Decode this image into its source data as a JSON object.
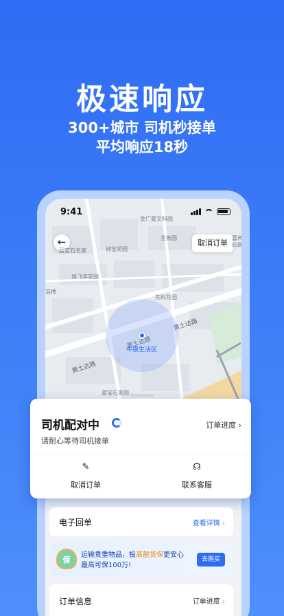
{
  "hero": {
    "title": "极速响应",
    "subtitle_line1": "300+城市 司机秒接单",
    "subtitle_line2": "平均响应18秒"
  },
  "status_bar": {
    "time": "9:41"
  },
  "map": {
    "cancel_order_button": "取消订单",
    "current_location": "中康生活区",
    "pois": [
      "金广夏文科园",
      "金燕园",
      "蓝宝石名庭",
      "钟宝花园",
      "旭飞华安园",
      "先科花园",
      "浩楼",
      "蓝宝石家园",
      "嘉市",
      "印刷"
    ],
    "roads": [
      "黄土达路",
      "黄土达路",
      "黄土达路"
    ]
  },
  "match_card": {
    "title": "司机配对中",
    "subtitle": "请耐心等待司机接单",
    "progress_link": "订单进度",
    "actions": [
      {
        "label": "取消订单",
        "icon": "cancel-order-icon"
      },
      {
        "label": "联系客服",
        "icon": "headset-icon"
      }
    ]
  },
  "receipt": {
    "title": "电子回单",
    "link": "查看详情"
  },
  "insurance": {
    "badge": "保",
    "text_prefix": "运输贵重物品，投",
    "text_highlight": "高额货保",
    "text_suffix": "更安心",
    "text_line2": "最高可保100万!",
    "button": "去购买"
  },
  "order_info": {
    "title": "订单信息",
    "link": "订单进度"
  },
  "colors": {
    "brand_blue": "#2f6cf4",
    "highlight_orange": "#f08a1c"
  }
}
